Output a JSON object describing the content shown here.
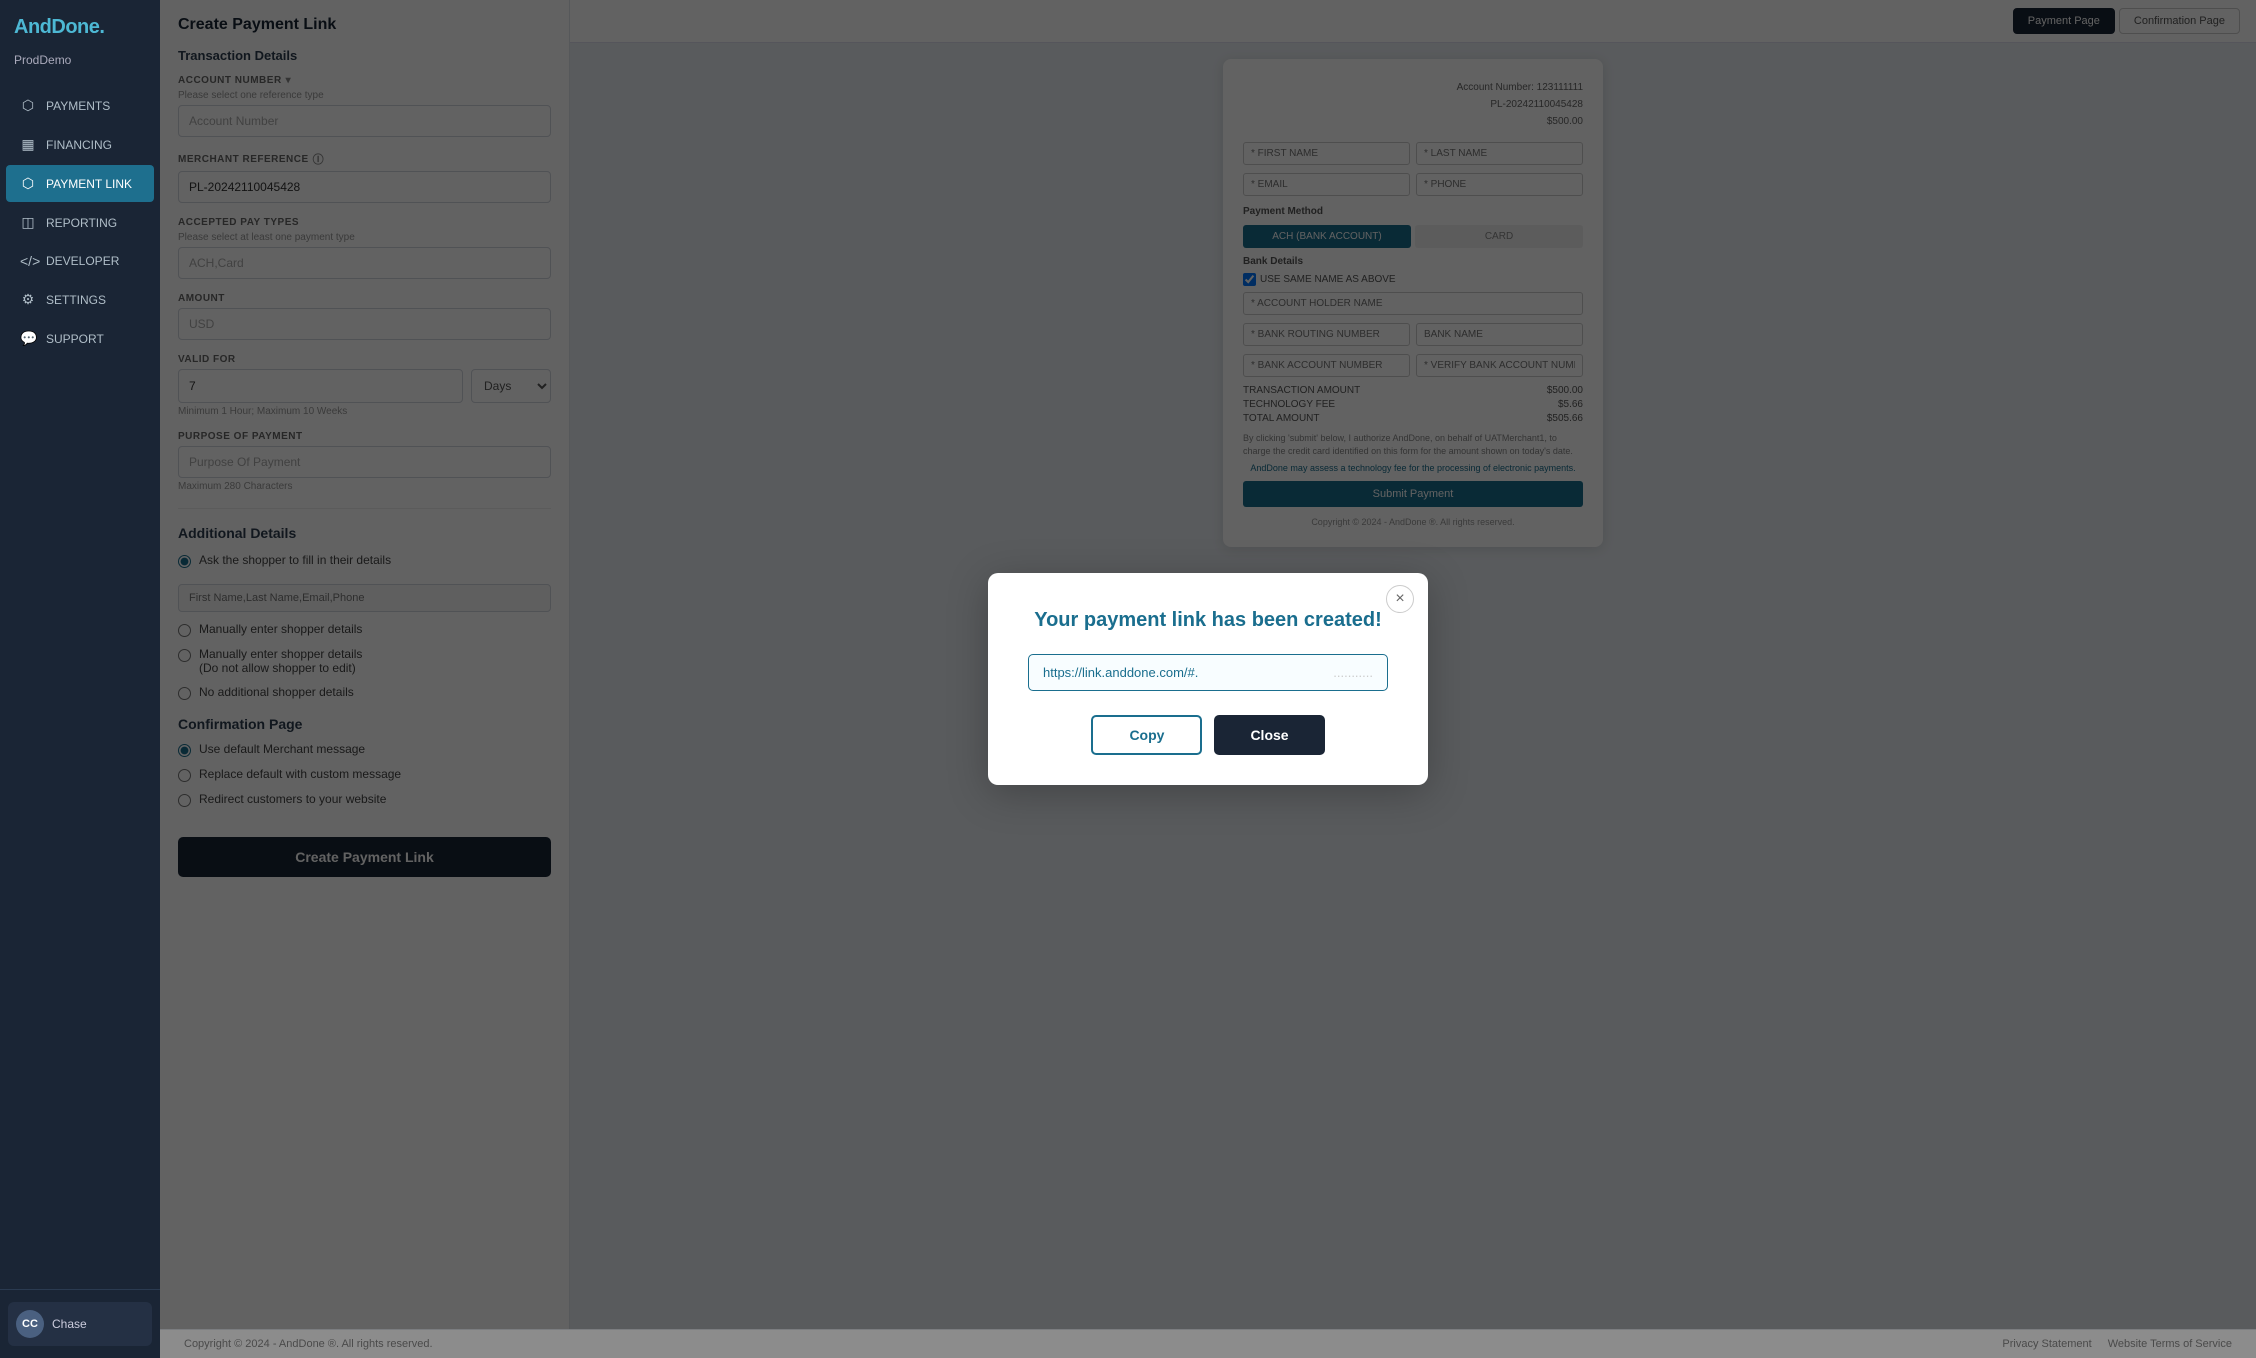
{
  "app": {
    "logo": "AndDone.",
    "logo_dot_color": "#4db8d4",
    "env": "ProdDemo"
  },
  "sidebar": {
    "items": [
      {
        "id": "payments",
        "label": "PAYMENTS",
        "icon": "💳"
      },
      {
        "id": "financing",
        "label": "FINANCING",
        "icon": "🏦"
      },
      {
        "id": "payment-link",
        "label": "PAYMENT LINK",
        "icon": "🔗",
        "active": true
      },
      {
        "id": "reporting",
        "label": "REPORTING",
        "icon": "📊"
      },
      {
        "id": "developer",
        "label": "DEVELOPER",
        "icon": "⚙️"
      },
      {
        "id": "settings",
        "label": "SETTINGS",
        "icon": "⚙"
      },
      {
        "id": "support",
        "label": "SUPPORT",
        "icon": "💬"
      }
    ],
    "user": {
      "initials": "CC",
      "name": "Chase"
    }
  },
  "page": {
    "title": "Create Payment Link",
    "transaction_details_title": "Transaction Details"
  },
  "form": {
    "account_number_label": "ACCOUNT NUMBER",
    "account_number_sublabel": "Please select one reference type",
    "account_number_placeholder": "Account Number",
    "merchant_reference_label": "MERCHANT REFERENCE",
    "merchant_reference_value": "PL-20242110045428",
    "accepted_pay_types_label": "ACCEPTED PAY TYPES",
    "accepted_pay_types_sublabel": "Please select at least one payment type",
    "accepted_pay_types_placeholder": "ACH,Card",
    "amount_label": "AMOUNT",
    "amount_placeholder": "USD",
    "valid_for_label": "VALID FOR",
    "valid_for_value": "7",
    "valid_for_unit": "Days",
    "valid_for_hint": "Minimum 1 Hour; Maximum 10 Weeks",
    "purpose_label": "PURPOSE OF PAYMENT",
    "purpose_placeholder": "Purpose Of Payment",
    "purpose_hint": "Maximum 280 Characters",
    "additional_details_title": "Additional Details",
    "shopper_ask_label": "Ask the shopper to fill in their details",
    "shopper_fields_placeholder": "First Name,Last Name,Email,Phone",
    "shopper_manual_label": "Manually enter shopper details",
    "shopper_manual_noedit_label": "Manually enter shopper details",
    "shopper_manual_noedit_sublabel": "(Do not allow shopper to edit)",
    "shopper_none_label": "No additional shopper details",
    "confirmation_page_title": "Confirmation Page",
    "confirmation_default_label": "Use default Merchant message",
    "confirmation_custom_label": "Replace default with custom message",
    "confirmation_redirect_label": "Redirect customers to your website",
    "create_button_label": "Create Payment Link"
  },
  "preview": {
    "tabs": [
      {
        "id": "payment",
        "label": "Payment Page",
        "active": true
      },
      {
        "id": "confirmation",
        "label": "Confirmation Page",
        "active": false
      }
    ],
    "meta": {
      "account_number_label": "Account Number:",
      "account_number_value": "123111111",
      "pl_label": "PL-20242110045428",
      "amount": "$500.00"
    },
    "form": {
      "first_name_placeholder": "* FIRST NAME",
      "last_name_placeholder": "* LAST NAME",
      "email_placeholder": "* EMAIL",
      "phone_placeholder": "* PHONE",
      "payment_method_label": "Payment Method",
      "ach_btn": "ACH (BANK ACCOUNT)",
      "card_btn": "CARD",
      "bank_details_label": "Bank Details",
      "same_name_checkbox": "USE SAME NAME AS ABOVE",
      "account_holder_placeholder": "* ACCOUNT HOLDER NAME",
      "routing_placeholder": "* BANK ROUTING NUMBER",
      "bank_name_placeholder": "BANK NAME",
      "bank_account_placeholder": "* BANK ACCOUNT NUMBER",
      "verify_account_placeholder": "* VERIFY BANK ACCOUNT NUMBER",
      "transaction_amount_label": "TRANSACTION AMOUNT",
      "transaction_amount_value": "$500.00",
      "technology_fee_label": "TECHNOLOGY FEE",
      "technology_fee_value": "$5.66",
      "total_amount_label": "TOTAL AMOUNT",
      "total_amount_value": "$505.66",
      "submit_btn": "Submit Payment",
      "consent_text": "By clicking 'submit' below, I authorize AndDone, on behalf of UATMerchant1, to charge the credit card identified on this form for the amount shown on today's date.",
      "ach_fee_text": "AndDone may assess a technology fee for the processing of electronic payments."
    }
  },
  "modal": {
    "title": "Your payment link has been created!",
    "link_prefix": "https://link.anddone.com/#.",
    "link_placeholder": "...........",
    "copy_btn": "Copy",
    "close_btn": "Close"
  },
  "footer": {
    "copyright": "Copyright © 2024 - AndDone ®. All rights reserved.",
    "privacy_label": "Privacy Statement",
    "terms_label": "Website Terms of Service"
  }
}
